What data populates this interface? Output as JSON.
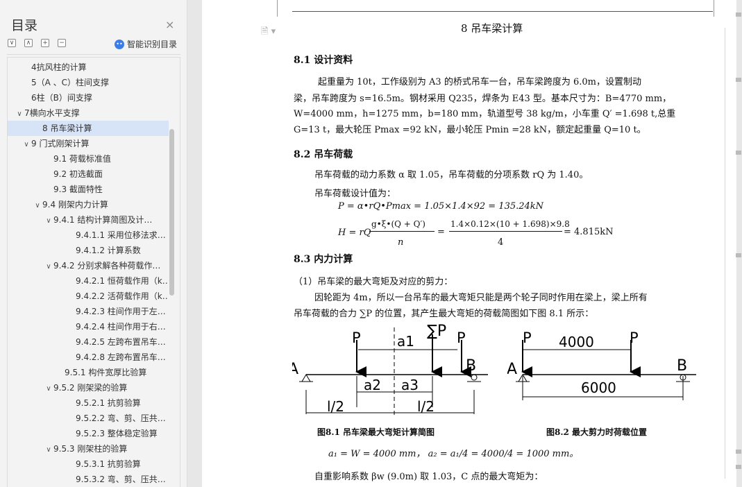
{
  "sidebar": {
    "title": "目录",
    "close": "×",
    "smart_toc": "智能识别目录",
    "items": [
      {
        "label": "4抗风柱的计算",
        "level": 1,
        "arrow": ""
      },
      {
        "label": "5（A 、C）柱间支撑",
        "level": 1,
        "arrow": ""
      },
      {
        "label": "6柱（B）间支撑",
        "level": 1,
        "arrow": ""
      },
      {
        "label": "7横向水平支撑",
        "level": 0,
        "arrow": "∨"
      },
      {
        "label": "8  吊车梁计算",
        "level": 2,
        "arrow": ""
      },
      {
        "label": "9  门式刚架计算",
        "level": 1,
        "arrow": "∨"
      },
      {
        "label": "9.1  荷载标准值",
        "level": 3,
        "arrow": ""
      },
      {
        "label": "9.2  初选截面",
        "level": 3,
        "arrow": ""
      },
      {
        "label": "9.3  截面特性",
        "level": 3,
        "arrow": ""
      },
      {
        "label": "9.4  刚架内力计算",
        "level": 2,
        "arrow": "∨"
      },
      {
        "label": "9.4.1  结构计算简图及计…",
        "level": 3,
        "arrow": "∨"
      },
      {
        "label": "9.4.1.1  采用位移法求…",
        "level": 5,
        "arrow": ""
      },
      {
        "label": "9.4.1.2  计算系数",
        "level": 5,
        "arrow": ""
      },
      {
        "label": "9.4.2 分别求解各种荷载作…",
        "level": 3,
        "arrow": "∨"
      },
      {
        "label": "9.4.2.1  恒荷载作用（k…",
        "level": 5,
        "arrow": ""
      },
      {
        "label": "9.4.2.2  活荷载作用（k…",
        "level": 5,
        "arrow": ""
      },
      {
        "label": "9.4.2.3  柱间作用于左…",
        "level": 5,
        "arrow": ""
      },
      {
        "label": "9.4.2.4  柱间作用于右…",
        "level": 5,
        "arrow": ""
      },
      {
        "label": "9.4.2.5  左跨布置吊车…",
        "level": 5,
        "arrow": ""
      },
      {
        "label": "9.4.2.8  左跨布置吊车…",
        "level": 5,
        "arrow": ""
      },
      {
        "label": "9.5.1  构件宽厚比验算",
        "level": 4,
        "arrow": ""
      },
      {
        "label": "9.5.2  刚架梁的验算",
        "level": 3,
        "arrow": "∨"
      },
      {
        "label": "9.5.2.1  抗剪验算",
        "level": 5,
        "arrow": ""
      },
      {
        "label": "9.5.2.2  弯、剪、压共…",
        "level": 5,
        "arrow": ""
      },
      {
        "label": "9.5.2.3  整体稳定验算",
        "level": 5,
        "arrow": ""
      },
      {
        "label": "9.5.3  刚架柱的验算",
        "level": 3,
        "arrow": "∨"
      },
      {
        "label": "9.5.3.1  抗剪验算",
        "level": 5,
        "arrow": ""
      },
      {
        "label": "9.5.3.2  弯、剪、压共…",
        "level": 5,
        "arrow": ""
      }
    ]
  },
  "document": {
    "chapter_title": "8  吊车梁计算",
    "s81_title": "8.1  设计资料",
    "s81_lines": [
      "起重量为 10t，工作级别为 A3 的桥式吊车一台，吊车梁跨度为 6.0m，设置制动",
      "梁，吊车跨度为 s=16.5m。钢材采用 Q235，焊条为 E43 型。基本尺寸为：B=4770 mm，",
      "W=4000 mm，h=1275 mm，b=180 mm，轨道型号 38 kg/m，小车重 Q′ =1.698 t,总重",
      "G=13 t，最大轮压 Pmax =92 kN，最小轮压 Pmin =28 kN，额定起重量 Q=10  t。"
    ],
    "s82_title": "8.2  吊车荷载",
    "s82_line1": "吊车荷载的动力系数 α 取 1.05，吊车荷载的分项系数 rQ 为 1.40。",
    "s82_line2": "吊车荷载设计值为：",
    "formula_P": "P = α•rQ•Pmax = 1.05×1.4×92 = 135.24kN",
    "formula_H_lhs": "H = rQ",
    "formula_H_num1": "g•ξ•(Q + Q′)",
    "formula_H_den1": "n",
    "formula_H_num2": "1.4×0.12×(10 + 1.698)×9.8",
    "formula_H_den2": "4",
    "formula_H_res": "= 4.815kN",
    "s83_title": "8.3  内力计算",
    "s83_item1": "（1）吊车梁的最大弯矩及对应的剪力：",
    "s83_line1": "因轮距为 4m，所以一台吊车的最大弯矩只能是两个轮子同时作用在梁上，梁上所有",
    "s83_line2": "吊车荷载的合力 ∑P 的位置，其产生最大弯矩的荷载简图如下图 8.1 所示：",
    "fig1_caption": "图8.1   吊车梁最大弯矩计算简图",
    "fig2_caption": "图8.2 最大剪力时荷载位置",
    "a_formula": "a₁ = W = 4000 mm，  a₂ = a₁/4 = 4000/4 = 1000 mm。",
    "last_line": "自重影响系数 βw (9.0m) 取 1.03，C 点的最大弯矩为："
  },
  "figure1": {
    "labels": {
      "P_left": "P",
      "a1": "a1",
      "sumP": "∑P",
      "P_right": "P",
      "A": "A",
      "B": "B",
      "a2": "a2",
      "a3": "a3",
      "l2_left": "l/2",
      "l2_right": "l/2"
    }
  },
  "figure2": {
    "labels": {
      "P_left": "P",
      "dim_top": "4000",
      "P_right": "P",
      "A": "A",
      "B": "B",
      "dim_bottom": "6000"
    }
  }
}
